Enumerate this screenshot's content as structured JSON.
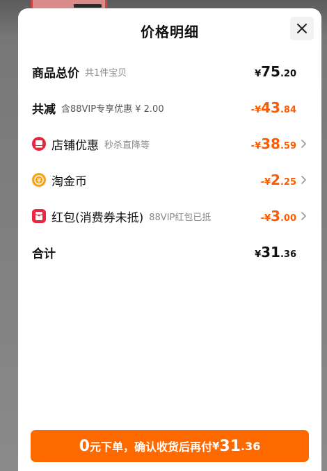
{
  "header": {
    "title": "价格明细"
  },
  "rows": {
    "total": {
      "label": "商品总价",
      "sub": "共1件宝贝",
      "pre": "¥",
      "int": "75",
      "dec": ".20"
    },
    "reduce": {
      "label": "共减",
      "sub": "含88VIP专享优惠 ¥ 2.00",
      "pre": "-¥",
      "int": "43",
      "dec": ".84"
    },
    "store": {
      "label": "店铺优惠",
      "sub": "秒杀直降等",
      "pre": "-¥",
      "int": "38",
      "dec": ".59"
    },
    "coin": {
      "label": "淘金币",
      "pre": "-¥",
      "int": "2",
      "dec": ".25"
    },
    "redpacket": {
      "label": "红包(消费券未抵)",
      "sub": "88VIP红包已抵",
      "pre": "-¥",
      "int": "3",
      "dec": ".00"
    },
    "sum": {
      "label": "合计",
      "pre": "¥",
      "int": "31",
      "dec": ".36"
    }
  },
  "button": {
    "zero": "0",
    "text": "元下单，确认收货后再付",
    "cur": "¥",
    "int": "31",
    "dec": ".36"
  },
  "icons": {
    "close": "close-icon",
    "store": "store-icon",
    "coin": "coin-icon",
    "redpacket": "red-packet-icon",
    "chevron": "chevron-right-icon"
  },
  "colors": {
    "accent": "#ff5a00",
    "button": "#ff6a00",
    "storeIcon": "#e8263f",
    "coinIcon": "#f6a21a",
    "redpacketIcon": "#e8263f"
  }
}
